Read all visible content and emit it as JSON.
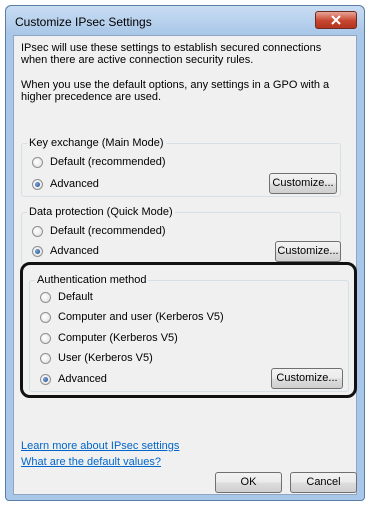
{
  "window": {
    "title": "Customize IPsec Settings",
    "close_icon": "close-icon"
  },
  "intro": {
    "line1": "IPsec will use these settings to establish secured connections when there are active connection security rules.",
    "line2": "When you use the default options, any settings in a GPO with a higher precedence are used."
  },
  "key_exchange": {
    "legend": "Key exchange (Main Mode)",
    "options": [
      "Default (recommended)",
      "Advanced"
    ],
    "selected": "Advanced",
    "customize_label": "Customize..."
  },
  "data_protection": {
    "legend": "Data protection (Quick Mode)",
    "options": [
      "Default (recommended)",
      "Advanced"
    ],
    "selected": "Advanced",
    "customize_label": "Customize..."
  },
  "authentication": {
    "legend": "Authentication method",
    "options": [
      "Default",
      "Computer and user (Kerberos V5)",
      "Computer (Kerberos V5)",
      "User (Kerberos V5)",
      "Advanced"
    ],
    "selected": "Advanced",
    "customize_label": "Customize..."
  },
  "links": {
    "learn_more": "Learn more about IPsec settings",
    "default_values": "What are the default values?"
  },
  "buttons": {
    "ok": "OK",
    "cancel": "Cancel"
  },
  "colors": {
    "link": "#0066cc",
    "close_button": "#c8452f",
    "highlight_border": "#111111"
  }
}
